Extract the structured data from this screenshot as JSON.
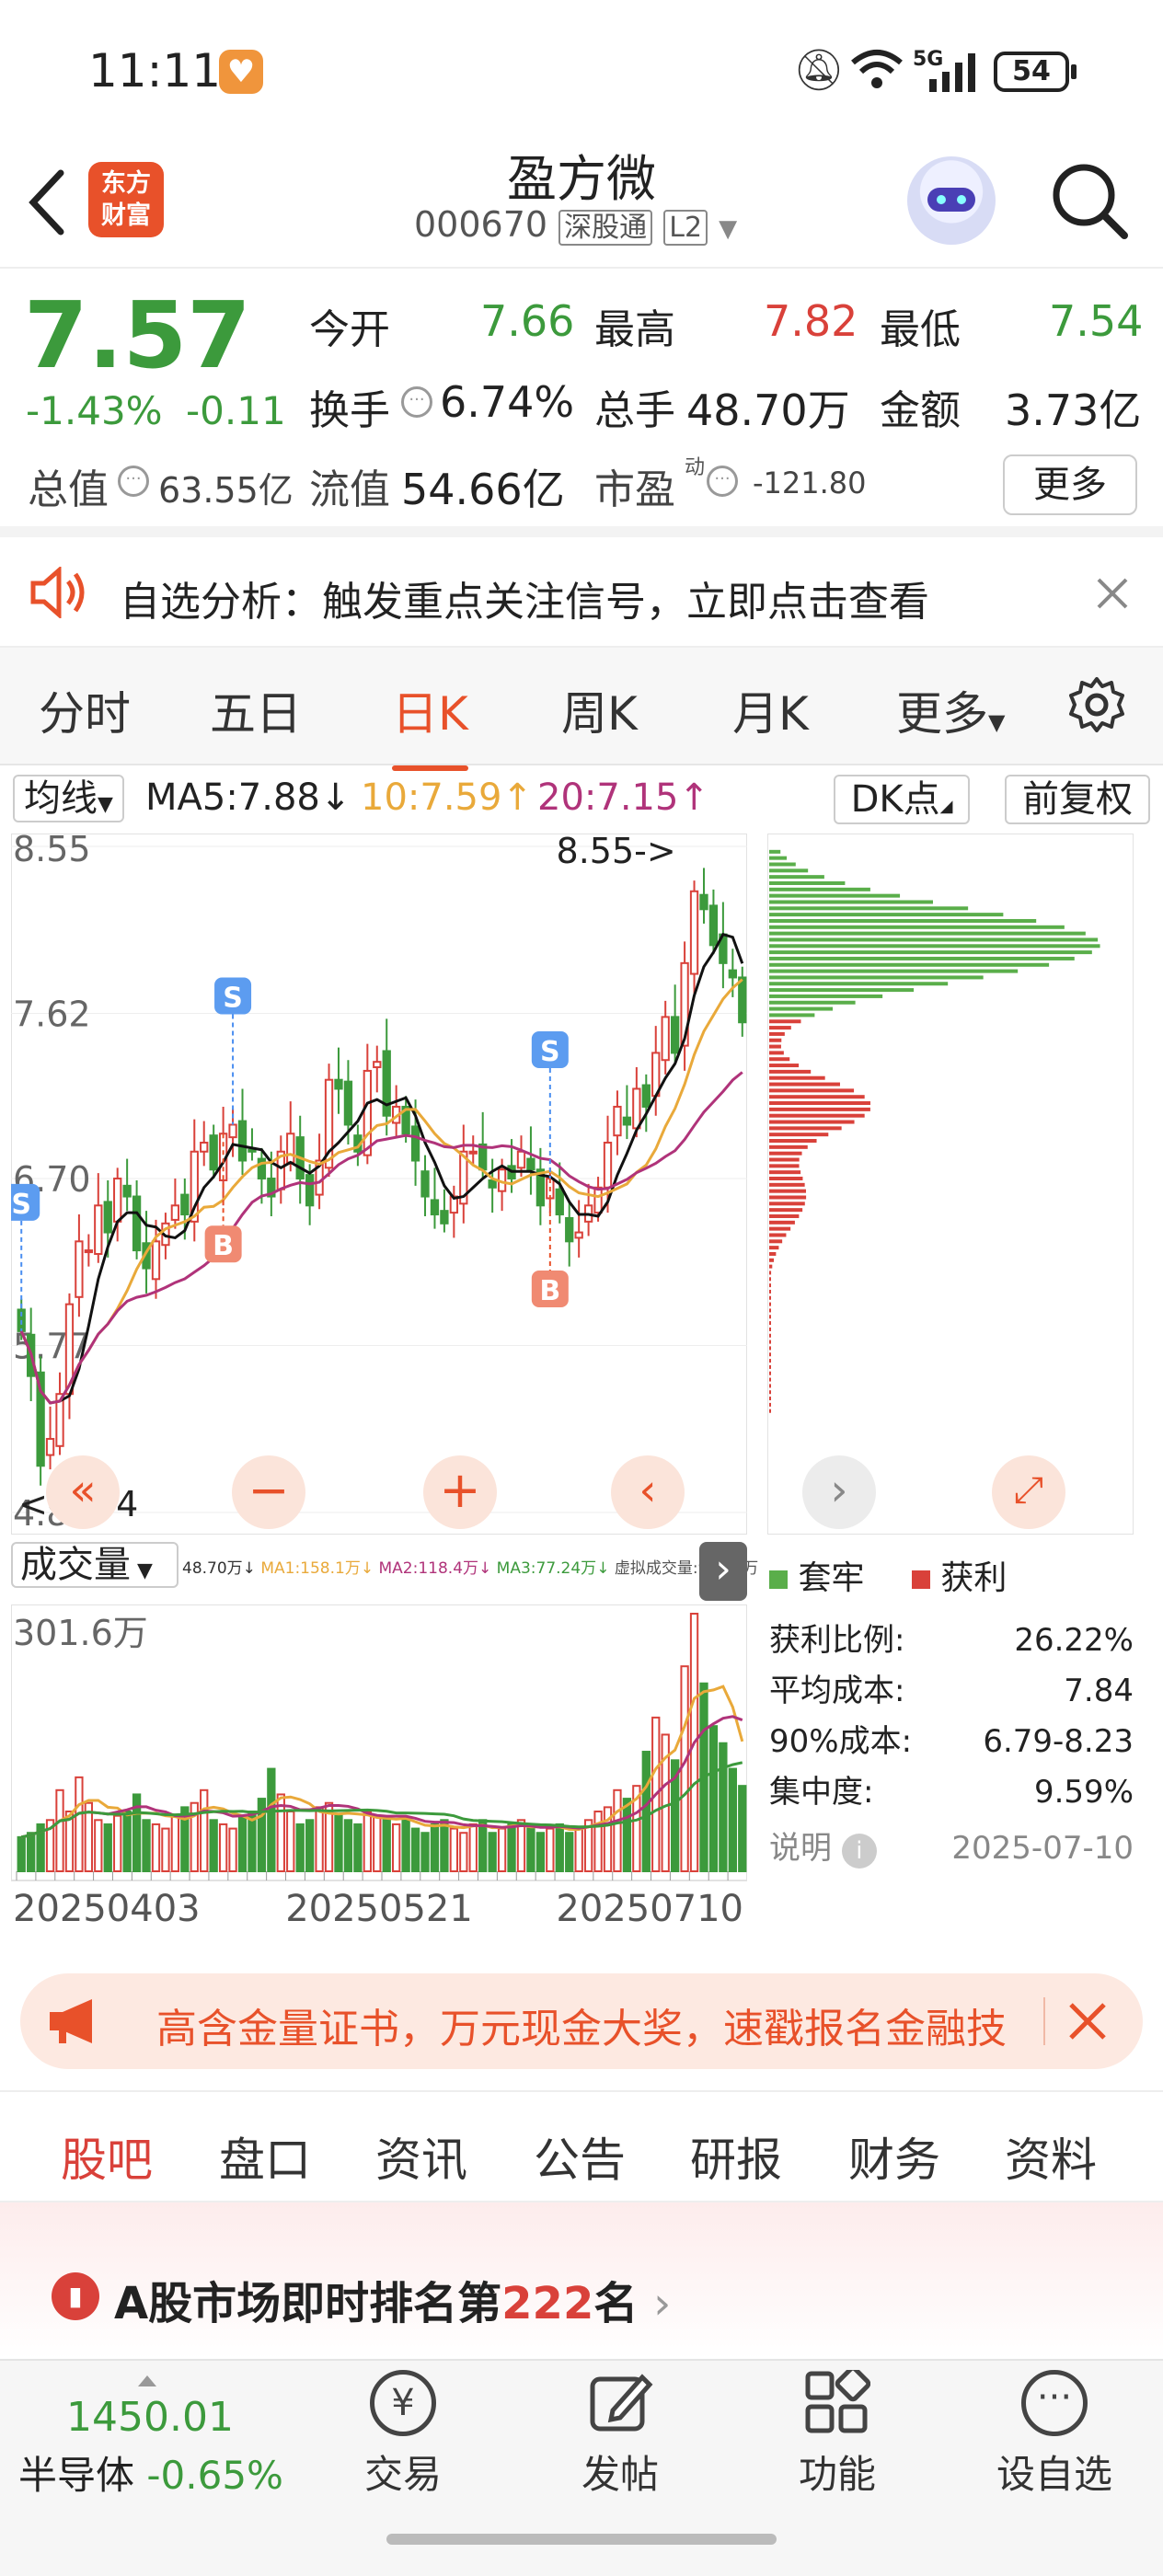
{
  "status_bar": {
    "time": "11:11",
    "network": "5G",
    "battery": "54"
  },
  "header": {
    "title": "盈方微",
    "code": "000670",
    "badge_market": "深股通",
    "badge_level": "L2",
    "logo_line1": "东方",
    "logo_line2": "财富"
  },
  "quote": {
    "price": "7.57",
    "change_pct": "-1.43%",
    "change": "-0.11",
    "open_label": "今开",
    "open": "7.66",
    "high_label": "最高",
    "high": "7.82",
    "low_label": "最低",
    "low": "7.54",
    "turnover_label": "换手",
    "turnover": "6.74%",
    "volume_label": "总手",
    "volume": "48.70万",
    "amount_label": "金额",
    "amount": "3.73亿",
    "mcap_label": "总值",
    "mcap": "63.55亿",
    "float_label": "流值",
    "float_value": "54.66亿",
    "pe_label": "市盈",
    "pe_sup": "动",
    "pe": "-121.80",
    "more_button": "更多"
  },
  "alert": {
    "text": "自选分析：触发重点关注信号，立即点击查看"
  },
  "kline_tabs": {
    "items": [
      "分时",
      "五日",
      "日K",
      "周K",
      "月K",
      "更多"
    ],
    "active_index": 2
  },
  "chart_data": {
    "type": "candlestick",
    "indicator_select": "均线",
    "ma5_label": "MA5:7.88",
    "ma10_label": "10:7.59",
    "ma20_label": "20:7.15",
    "dk_button": "DK点",
    "adjust_button": "前复权",
    "y_ticks": [
      "8.55",
      "7.62",
      "6.70",
      "5.77",
      "4.84"
    ],
    "high_marker": "8.55->",
    "low_marker": "<-4.84",
    "signals": [
      {
        "type": "S",
        "x_idx": 0
      },
      {
        "type": "S",
        "x_idx": 22
      },
      {
        "type": "B",
        "x_idx": 21
      },
      {
        "type": "S",
        "x_idx": 55
      },
      {
        "type": "B",
        "x_idx": 55
      }
    ],
    "ylim": [
      4.84,
      8.55
    ],
    "close": [
      5.85,
      5.6,
      5.1,
      5.25,
      5.5,
      6.0,
      6.35,
      6.3,
      6.55,
      6.4,
      6.7,
      6.6,
      6.3,
      6.2,
      6.35,
      6.45,
      6.55,
      6.5,
      6.85,
      6.9,
      6.75,
      6.95,
      7.0,
      6.8,
      6.85,
      6.7,
      6.6,
      6.85,
      6.95,
      6.7,
      6.55,
      6.8,
      7.25,
      7.2,
      7.0,
      6.85,
      7.3,
      7.35,
      7.05,
      7.1,
      6.95,
      6.8,
      6.6,
      6.5,
      6.45,
      6.6,
      6.85,
      6.85,
      6.75,
      6.65,
      6.75,
      6.7,
      6.85,
      6.75,
      6.55,
      6.7,
      6.5,
      6.35,
      6.4,
      6.55,
      6.65,
      6.9,
      7.1,
      7.0,
      7.2,
      7.1,
      7.4,
      7.6,
      7.4,
      7.9,
      8.3,
      8.2,
      8.0,
      7.9,
      7.82,
      7.57
    ],
    "volume_panel": {
      "selector": "成交量",
      "legend": [
        "48.70万",
        "MA1:158.1万",
        "MA2:118.4万",
        "MA3:77.24万",
        "虚拟成交量:92.88万"
      ],
      "max_label": "301.6万",
      "ymax": 301.6,
      "x_labels": [
        "20250403",
        "20250521",
        "20250710"
      ],
      "volumes": [
        40,
        45,
        55,
        60,
        95,
        70,
        110,
        80,
        60,
        55,
        65,
        70,
        90,
        60,
        55,
        50,
        65,
        75,
        80,
        95,
        60,
        55,
        50,
        65,
        70,
        85,
        120,
        90,
        70,
        55,
        60,
        75,
        80,
        65,
        60,
        55,
        70,
        65,
        60,
        55,
        60,
        50,
        45,
        55,
        60,
        50,
        45,
        55,
        60,
        45,
        50,
        55,
        60,
        50,
        45,
        50,
        55,
        45,
        50,
        60,
        70,
        75,
        95,
        85,
        100,
        140,
        180,
        160,
        130,
        240,
        301.6,
        220,
        170,
        150,
        120,
        100
      ]
    },
    "chip_distribution": {
      "legend": [
        "套牢",
        "获利"
      ],
      "rows": [
        {
          "label": "获利比例:",
          "value": "26.22%"
        },
        {
          "label": "平均成本:",
          "value": "7.84"
        },
        {
          "label": "90%成本:",
          "value": "6.79-8.23"
        },
        {
          "label": "集中度:",
          "value": "9.59%"
        }
      ],
      "note_label": "说明",
      "date": "2025-07-10"
    }
  },
  "banner": {
    "text": "高含金量证书，万元现金大奖，速戳报名金融技"
  },
  "bottom_tabs": {
    "items": [
      "股吧",
      "盘口",
      "资讯",
      "公告",
      "研报",
      "财务",
      "资料"
    ],
    "active_index": 0
  },
  "rank": {
    "prefix": "A股市场即时排名第",
    "number": "222",
    "suffix": "名"
  },
  "dock": {
    "index_value": "1450.01",
    "index_name": "半导体",
    "index_change": "-0.65%",
    "items": [
      {
        "label": "交易",
        "icon": "yuan-icon"
      },
      {
        "label": "发帖",
        "icon": "edit-icon"
      },
      {
        "label": "功能",
        "icon": "grid-icon"
      },
      {
        "label": "设自选",
        "icon": "more-icon"
      }
    ]
  },
  "colors": {
    "up": "#d9413a",
    "down": "#3c9a3c",
    "accent": "#e8512a"
  }
}
